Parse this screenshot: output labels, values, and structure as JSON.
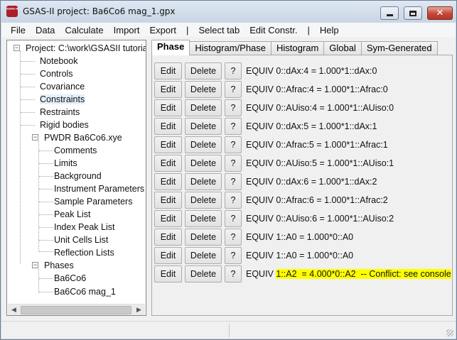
{
  "window": {
    "title": "GSAS-II project: Ba6Co6 mag_1.gpx",
    "icon_text": "GSAS-II"
  },
  "menu": [
    "File",
    "Data",
    "Calculate",
    "Import",
    "Export",
    "|",
    "Select tab",
    "Edit Constr.",
    "|",
    "Help"
  ],
  "tree": {
    "root": "Project: C:\\work\\GSASII tutorials",
    "items": [
      "Notebook",
      "Controls",
      "Covariance",
      "Constraints",
      "Restraints",
      "Rigid bodies"
    ],
    "selected": "Constraints",
    "histogram": "PWDR Ba6Co6.xye",
    "histogram_items": [
      "Comments",
      "Limits",
      "Background",
      "Instrument Parameters",
      "Sample Parameters",
      "Peak List",
      "Index Peak List",
      "Unit Cells List",
      "Reflection Lists"
    ],
    "phases_label": "Phases",
    "phases": [
      "Ba6Co6",
      "Ba6Co6 mag_1"
    ]
  },
  "tabs": [
    {
      "label": "Phase",
      "active": true
    },
    {
      "label": "Histogram/Phase",
      "active": false
    },
    {
      "label": "Histogram",
      "active": false
    },
    {
      "label": "Global",
      "active": false
    },
    {
      "label": "Sym-Generated",
      "active": false
    }
  ],
  "buttons": {
    "edit": "Edit",
    "delete": "Delete",
    "help": "?"
  },
  "constraints": [
    {
      "text": "EQUIV 0::dAx:4  = 1.000*1::dAx:0"
    },
    {
      "text": "EQUIV 0::Afrac:4  = 1.000*1::Afrac:0"
    },
    {
      "text": "EQUIV 0::AUiso:4  = 1.000*1::AUiso:0"
    },
    {
      "text": "EQUIV 0::dAx:5  = 1.000*1::dAx:1"
    },
    {
      "text": "EQUIV 0::Afrac:5  = 1.000*1::Afrac:1"
    },
    {
      "text": "EQUIV 0::AUiso:5  = 1.000*1::AUiso:1"
    },
    {
      "text": "EQUIV 0::dAx:6  = 1.000*1::dAx:2"
    },
    {
      "text": "EQUIV 0::Afrac:6  = 1.000*1::Afrac:2"
    },
    {
      "text": "EQUIV 0::AUiso:6  = 1.000*1::AUiso:2"
    },
    {
      "text": "EQUIV 1::A0  = 1.000*0::A0"
    },
    {
      "text": "EQUIV 1::A0  = 1.000*0::A0"
    },
    {
      "text_prefix": "EQUIV ",
      "highlighted": "1::A2  = 4.000*0::A2  -- Conflict: see console",
      "highlight_color": "#ffff00"
    }
  ]
}
